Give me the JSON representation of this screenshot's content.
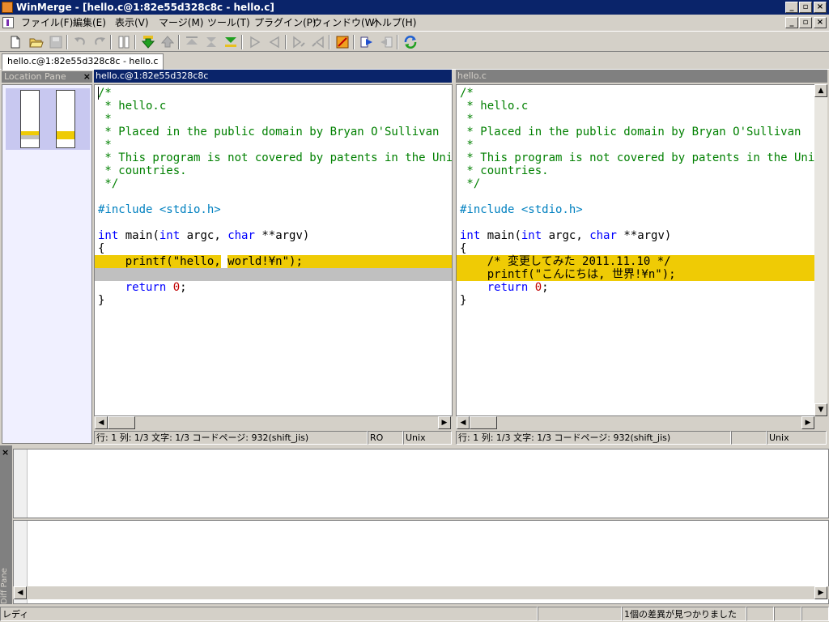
{
  "window": {
    "title": "WinMerge - [hello.c@1:82e55d328c8c - hello.c]",
    "controls": {
      "minimize": "_",
      "restore": "▫",
      "close": "×"
    }
  },
  "menu": {
    "items": [
      {
        "label": "ファイル(F)"
      },
      {
        "label": "編集(E)"
      },
      {
        "label": "表示(V)"
      },
      {
        "label": "マージ(M)"
      },
      {
        "label": "ツール(T)"
      },
      {
        "label": "プラグイン(P)"
      },
      {
        "label": "ウィンドウ(W)"
      },
      {
        "label": "ヘルプ(H)"
      }
    ]
  },
  "tab": {
    "label": "hello.c@1:82e55d328c8c - hello.c"
  },
  "location_pane": {
    "title": "Location Pane",
    "close": "×"
  },
  "left_pane": {
    "title": "hello.c@1:82e55d328c8c",
    "status": {
      "position": "行: 1  列: 1/3  文字: 1/3  コードページ: 932(shift_jis)",
      "ro": "RO",
      "eol": "Unix"
    }
  },
  "right_pane": {
    "title": "hello.c",
    "status": {
      "position": "行: 1  列: 1/3  文字: 1/3  コードページ: 932(shift_jis)",
      "ro": "",
      "eol": "Unix"
    }
  },
  "code_left": {
    "l1": "/*",
    "l2": " * hello.c",
    "l3": " *",
    "l4": " * Placed in the public domain by Bryan O'Sullivan",
    "l5": " *",
    "l6": " * This program is not covered by patents in the United States or other",
    "l7": " * countries.",
    "l8": " */",
    "inc": "#include <stdio.h>",
    "main_kw1": "int",
    "main_fn": " main(",
    "main_kw2": "int",
    "main_a": " argc, ",
    "main_kw3": "char",
    "main_b": " **argv)",
    "brace_open": "{",
    "printf_a": "    printf(\"hello,",
    "printf_b": " ",
    "printf_c": "world!¥n\");",
    "ret_kw": "return",
    "ret_num": "0",
    "ret_end": ";",
    "brace_close": "}"
  },
  "code_right": {
    "l1": "/*",
    "l2": " * hello.c",
    "l3": " *",
    "l4": " * Placed in the public domain by Bryan O'Sullivan",
    "l5": " *",
    "l6": " * This program is not covered by patents in the United States or other",
    "l7": " * countries.",
    "l8": " */",
    "inc": "#include <stdio.h>",
    "main_kw1": "int",
    "main_fn": " main(",
    "main_kw2": "int",
    "main_a": " argc, ",
    "main_kw3": "char",
    "main_b": " **argv)",
    "brace_open": "{",
    "added_comment": "    /* 変更してみた 2011.11.10 */",
    "printf": "    printf(\"こんにちは, 世界!¥n\");",
    "ret_kw": "return",
    "ret_num": "0",
    "ret_end": ";",
    "brace_close": "}"
  },
  "diff_pane": {
    "label": "Diff Pane",
    "close": "×"
  },
  "statusbar": {
    "left": "レディ",
    "diff_count": "1個の差異が見つかりました"
  },
  "colors": {
    "diff_highlight": "#efcb05",
    "title_bar": "#0a246a",
    "keyword": "#0000ff",
    "comment": "#008000"
  },
  "toolbar_icons": [
    "new-icon",
    "open-icon",
    "save-icon",
    "undo-icon",
    "redo-icon",
    "compare-icon",
    "next-diff-icon",
    "prev-diff-icon",
    "first-diff-icon",
    "last-diff-icon",
    "current-diff-icon",
    "copy-right-icon",
    "copy-left-icon",
    "copy-right-advance-icon",
    "copy-left-advance-icon",
    "options-icon",
    "open-conflict-icon",
    "refresh-icon",
    "rescan-icon"
  ]
}
